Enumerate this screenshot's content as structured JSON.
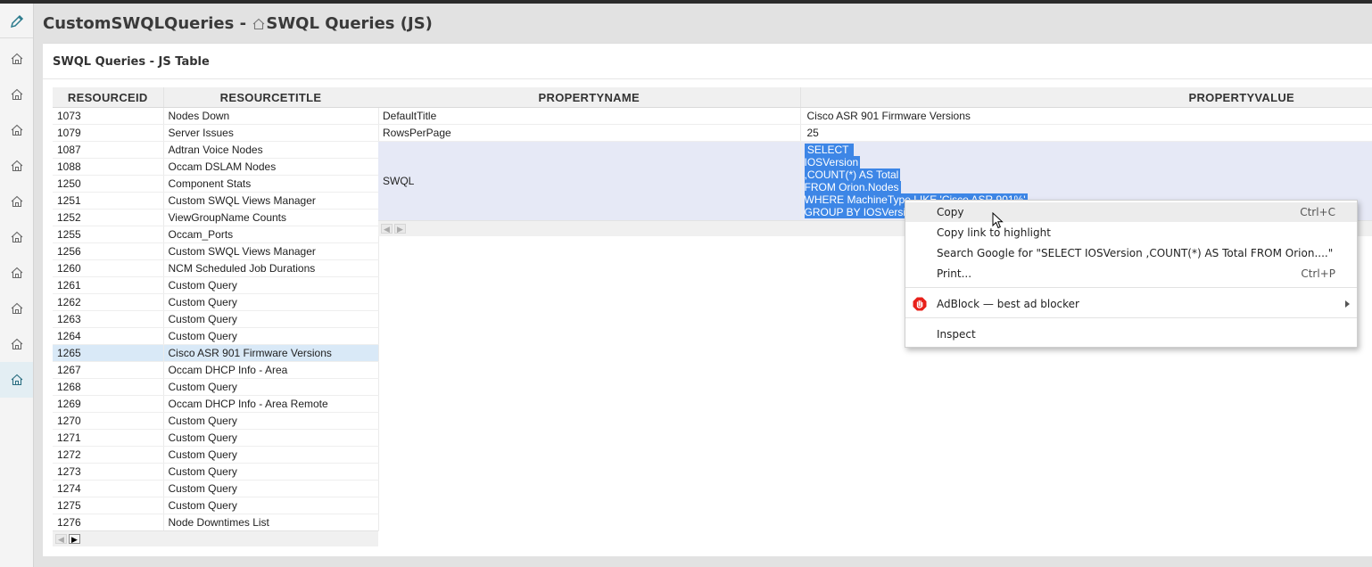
{
  "header": {
    "title_prefix": "CustomSWQLQueries - ",
    "title_view": "SWQL Queries (JS)"
  },
  "panel": {
    "title": "SWQL Queries - JS Table"
  },
  "left_table": {
    "columns": [
      "RESOURCEID",
      "RESOURCETITLE"
    ],
    "rows": [
      [
        "1073",
        "Nodes Down"
      ],
      [
        "1079",
        "Server Issues"
      ],
      [
        "1087",
        "Adtran Voice Nodes"
      ],
      [
        "1088",
        "Occam DSLAM Nodes"
      ],
      [
        "1250",
        "Component Stats"
      ],
      [
        "1251",
        "Custom SWQL Views Manager"
      ],
      [
        "1252",
        "ViewGroupName Counts"
      ],
      [
        "1255",
        "Occam_Ports"
      ],
      [
        "1256",
        "Custom SWQL Views Manager"
      ],
      [
        "1260",
        "NCM Scheduled Job Durations"
      ],
      [
        "1261",
        "Custom Query"
      ],
      [
        "1262",
        "Custom Query"
      ],
      [
        "1263",
        "Custom Query"
      ],
      [
        "1264",
        "Custom Query"
      ],
      [
        "1265",
        "Cisco ASR 901 Firmware Versions"
      ],
      [
        "1267",
        "Occam DHCP Info - Area"
      ],
      [
        "1268",
        "Custom Query"
      ],
      [
        "1269",
        "Occam DHCP Info - Area Remote"
      ],
      [
        "1270",
        "Custom Query"
      ],
      [
        "1271",
        "Custom Query"
      ],
      [
        "1272",
        "Custom Query"
      ],
      [
        "1273",
        "Custom Query"
      ],
      [
        "1274",
        "Custom Query"
      ],
      [
        "1275",
        "Custom Query"
      ],
      [
        "1276",
        "Node Downtimes List"
      ]
    ],
    "selected_index": 14
  },
  "right_table": {
    "columns": [
      "PROPERTYNAME",
      "PROPERTYVALUE"
    ],
    "rows": [
      {
        "name": "DefaultTitle",
        "value": "Cisco ASR 901 Firmware Versions"
      },
      {
        "name": "RowsPerPage",
        "value": "25"
      },
      {
        "name": "SWQL",
        "value_lines": [
          " SELECT ",
          "IOSVersion",
          ",COUNT(*) AS Total",
          "FROM Orion.Nodes",
          "WHERE MachineType LIKE 'Cisco ASR 901%'",
          "GROUP BY IOSVersion"
        ]
      }
    ]
  },
  "context_menu": {
    "items": [
      {
        "label": "Copy",
        "shortcut": "Ctrl+C"
      },
      {
        "label": "Copy link to highlight",
        "shortcut": ""
      },
      {
        "label": "Search Google for \"SELECT  IOSVersion ,COUNT(*) AS Total FROM Orion....\"",
        "shortcut": ""
      },
      {
        "label": "Print...",
        "shortcut": "Ctrl+P"
      },
      {
        "label": "AdBlock — best ad blocker",
        "shortcut": ""
      },
      {
        "label": "Inspect",
        "shortcut": ""
      }
    ]
  },
  "colors": {
    "selection": "#3d86e6",
    "row_selected": "#d9e9f7",
    "adblock": "#e8201a",
    "accent_pencil": "#2a7a8c"
  },
  "icons": {
    "sidebar": [
      "pencil-icon",
      "home-icon"
    ],
    "menu": [
      "adblock-icon"
    ],
    "cursor": "mouse-pointer-icon"
  }
}
